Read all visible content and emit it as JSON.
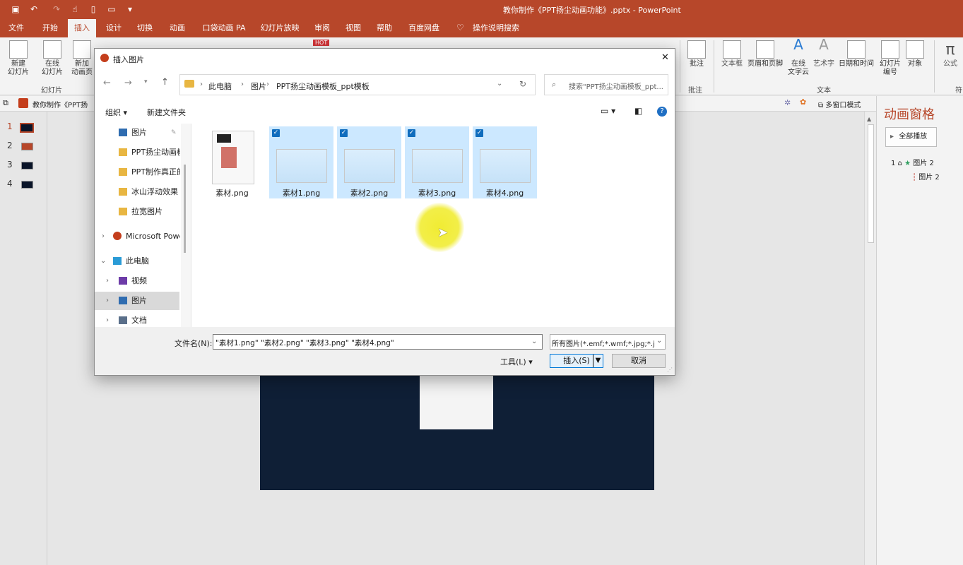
{
  "app": {
    "title": "教你制作《PPT扬尘动画功能》.pptx  -  PowerPoint",
    "qat_icons": [
      "save-icon",
      "undo-icon",
      "redo-icon",
      "touch-mode-icon",
      "new-icon",
      "open-icon",
      "customize-icon"
    ]
  },
  "tabs": [
    "文件",
    "开始",
    "插入",
    "设计",
    "切换",
    "动画",
    "口袋动画 PA",
    "幻灯片放映",
    "审阅",
    "视图",
    "帮助",
    "百度网盘",
    "操作说明搜索"
  ],
  "active_tab": "插入",
  "ribbon": {
    "new_slide": "新建\n幻灯片",
    "online_slide": "在线\n幻灯片",
    "new_anim_page": "新加\n动画页",
    "group_slides": "幻灯片",
    "hot_badge": "HOT",
    "comment": "批注",
    "group_comment": "批注",
    "textbox": "文本框",
    "header_footer": "页眉和页脚",
    "online_wordart": "在线\n文字云",
    "wordart": "艺术字",
    "datetime": "日期和时间",
    "slide_number": "幻灯片\n编号",
    "object": "对象",
    "group_text": "文本",
    "equation": "公式",
    "group_symbol": "符"
  },
  "subbar": {
    "doc_tab": "教你制作《PPT扬",
    "multiwindow": "多窗口模式"
  },
  "thumbnails": [
    "1",
    "2",
    "3",
    "4"
  ],
  "anim_pane": {
    "title": "动画窗格",
    "play_all": "全部播放",
    "items": [
      {
        "num": "1",
        "label": "图片 2"
      },
      {
        "num": "",
        "label": "图片 2"
      }
    ]
  },
  "dialog": {
    "title": "插入图片",
    "breadcrumb": [
      "此电脑",
      "图片",
      "PPT扬尘动画模板_ppt模板"
    ],
    "search_placeholder": "搜索\"PPT扬尘动画模板_ppt...",
    "organize": "组织",
    "new_folder": "新建文件夹",
    "nav": [
      {
        "label": "图片",
        "icon": "pictures-icon",
        "pinned": true
      },
      {
        "label": "PPT扬尘动画模",
        "icon": "folder-icon"
      },
      {
        "label": "PPT制作真正的",
        "icon": "folder-icon"
      },
      {
        "label": "冰山浮动效果",
        "icon": "folder-icon"
      },
      {
        "label": "拉宽图片",
        "icon": "folder-icon"
      },
      {
        "label": "Microsoft Powe",
        "icon": "powerpoint-icon"
      },
      {
        "label": "此电脑",
        "icon": "pc-icon"
      },
      {
        "label": "视频",
        "icon": "video-icon"
      },
      {
        "label": "图片",
        "icon": "pictures-icon"
      },
      {
        "label": "文档",
        "icon": "documents-icon"
      }
    ],
    "files": [
      {
        "name": "素材.png",
        "selected": false
      },
      {
        "name": "素材1.png",
        "selected": true
      },
      {
        "name": "素材2.png",
        "selected": true
      },
      {
        "name": "素材3.png",
        "selected": true
      },
      {
        "name": "素材4.png",
        "selected": true
      }
    ],
    "filename_label": "文件名(N):",
    "filename_value": "\"素材1.png\" \"素材2.png\" \"素材3.png\" \"素材4.png\"",
    "filetype": "所有图片(*.emf;*.wmf;*.jpg;*.j",
    "tools": "工具(L)",
    "insert": "插入(S)",
    "cancel": "取消",
    "close": "✕"
  },
  "colors": {
    "accent": "#b7472a",
    "selection": "#cce8ff",
    "check": "#0f6cbd",
    "slide_bg": "#0f1f36"
  }
}
